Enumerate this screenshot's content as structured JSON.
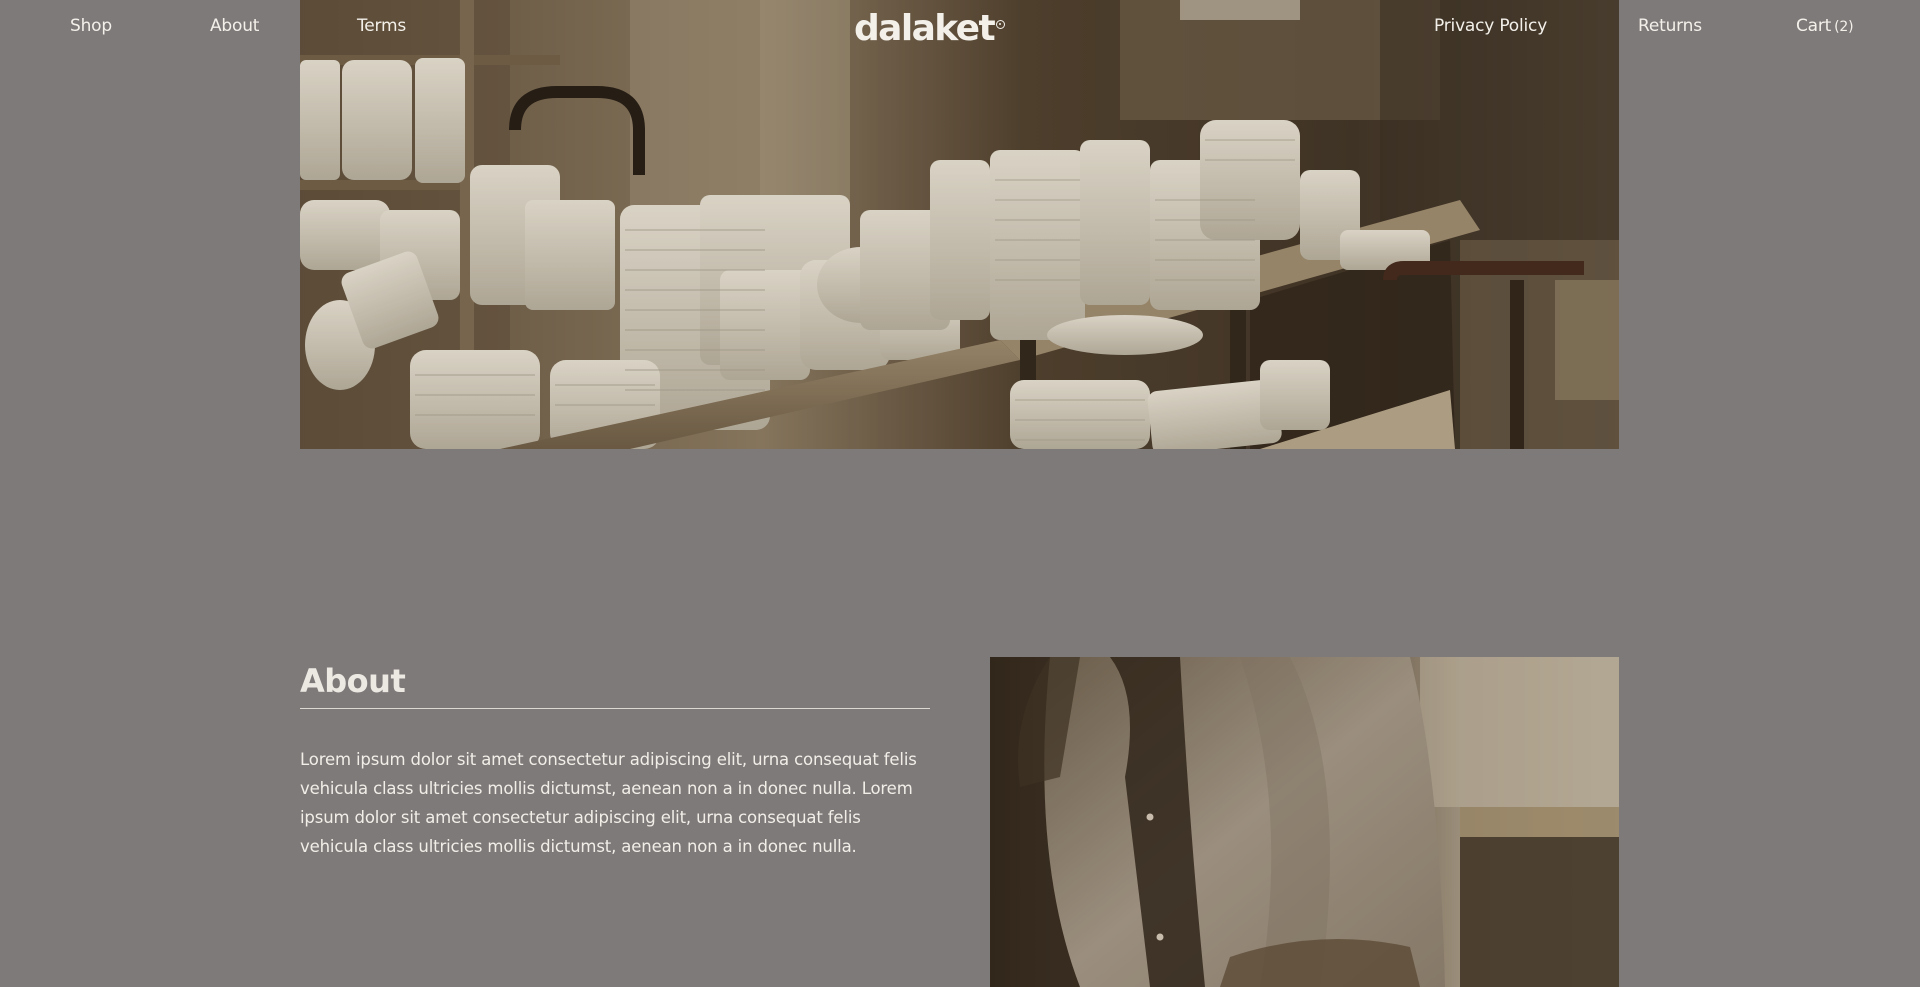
{
  "nav": {
    "left_links": [
      {
        "label": "Shop"
      },
      {
        "label": "About"
      },
      {
        "label": "Terms"
      }
    ],
    "logo": "dalaket",
    "right_links": [
      {
        "label": "Privacy Policy"
      },
      {
        "label": "Returns"
      }
    ],
    "cart": {
      "label": "Cart",
      "count": "(2)"
    }
  },
  "about": {
    "title": "About",
    "body": "Lorem ipsum dolor sit amet consectetur adipiscing elit, urna consequat felis vehicula class ultricies mollis dictumst, aenean non a in donec nulla. Lorem ipsum dolor sit amet consectetur adipiscing elit, urna consequat felis vehicula class ultricies mollis dictumst, aenean non a in donec nulla."
  },
  "colors": {
    "page_background": "#7f7a7a",
    "text": "#f2efea"
  },
  "icons": {
    "logo_mark": "registered-mark-icon"
  }
}
